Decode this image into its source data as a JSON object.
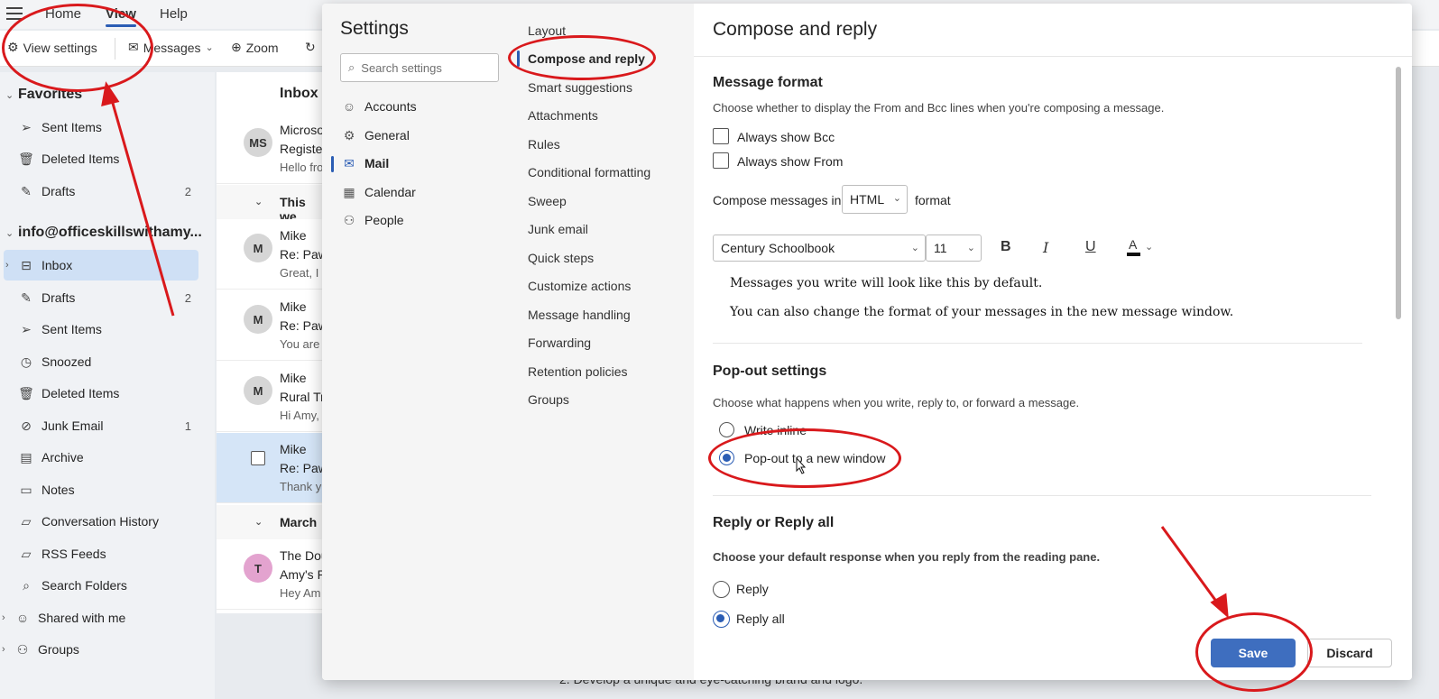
{
  "ribbon": {
    "tabs": [
      "Home",
      "View",
      "Help"
    ],
    "toolbar": {
      "view_settings": "View settings",
      "messages": "Messages",
      "zoom": "Zoom"
    }
  },
  "nav": {
    "favorites_header": "Favorites",
    "favorites": [
      {
        "label": "Sent Items",
        "icon": "send-icon",
        "count": ""
      },
      {
        "label": "Deleted Items",
        "icon": "trash-icon",
        "count": ""
      },
      {
        "label": "Drafts",
        "icon": "pencil-icon",
        "count": "2"
      }
    ],
    "account": "info@officeskillswithamy...",
    "folders": [
      {
        "label": "Inbox",
        "icon": "inbox-icon",
        "count": ""
      },
      {
        "label": "Drafts",
        "icon": "pencil-icon",
        "count": "2"
      },
      {
        "label": "Sent Items",
        "icon": "send-icon",
        "count": ""
      },
      {
        "label": "Snoozed",
        "icon": "clock-icon",
        "count": ""
      },
      {
        "label": "Deleted Items",
        "icon": "trash-icon",
        "count": ""
      },
      {
        "label": "Junk Email",
        "icon": "junk-icon",
        "count": "1"
      },
      {
        "label": "Archive",
        "icon": "archive-icon",
        "count": ""
      },
      {
        "label": "Notes",
        "icon": "note-icon",
        "count": ""
      },
      {
        "label": "Conversation History",
        "icon": "folder-icon",
        "count": ""
      },
      {
        "label": "RSS Feeds",
        "icon": "folder-icon",
        "count": ""
      },
      {
        "label": "Search Folders",
        "icon": "search-folder-icon",
        "count": ""
      },
      {
        "label": "Shared with me",
        "icon": "person-icon",
        "count": ""
      },
      {
        "label": "Groups",
        "icon": "groups-icon",
        "count": ""
      }
    ]
  },
  "message_list": {
    "header": "Inbox",
    "groups": [
      "This we",
      "March"
    ],
    "messages": [
      {
        "initials": "MS",
        "from": "Microso",
        "subject": "Register",
        "preview": "Hello fro",
        "avatar_color": "#d6d6d6"
      },
      {
        "initials": "M",
        "from": "Mike",
        "subject": "Re: Paw",
        "preview": "Great, I",
        "avatar_color": "#d6d6d6"
      },
      {
        "initials": "M",
        "from": "Mike",
        "subject": "Re: Paw",
        "preview": "You are",
        "avatar_color": "#d6d6d6"
      },
      {
        "initials": "M",
        "from": "Mike",
        "subject": "Rural Tra",
        "preview": "Hi Amy,",
        "avatar_color": "#d6d6d6"
      },
      {
        "initials": "",
        "from": "Mike",
        "subject": "Re: Paw",
        "preview": "Thank y",
        "avatar_color": "#d6d6d6"
      },
      {
        "initials": "T",
        "from": "The Dou",
        "subject": "Amy's P",
        "preview": "Hey Am",
        "avatar_color": "#e3a3cf"
      }
    ]
  },
  "settings": {
    "title": "Settings",
    "search_placeholder": "Search settings",
    "categories": [
      "Accounts",
      "General",
      "Mail",
      "Calendar",
      "People"
    ],
    "active_category": "Mail",
    "subcategories": [
      "Layout",
      "Compose and reply",
      "Smart suggestions",
      "Attachments",
      "Rules",
      "Conditional formatting",
      "Sweep",
      "Junk email",
      "Quick steps",
      "Customize actions",
      "Message handling",
      "Forwarding",
      "Retention policies",
      "Groups"
    ],
    "active_subcategory": "Compose and reply",
    "panel": {
      "title": "Compose and reply",
      "message_format": {
        "heading": "Message format",
        "description": "Choose whether to display the From and Bcc lines when you're composing a message.",
        "always_show_bcc": "Always show Bcc",
        "always_show_from": "Always show From",
        "compose_in_label": "Compose messages in",
        "compose_in_value": "HTML",
        "format_suffix": "format",
        "font_name": "Century Schoolbook",
        "font_size": "11",
        "preview_line1": "Messages you write will look like this by default.",
        "preview_line2": "You can also change the format of your messages in the new message window."
      },
      "popout": {
        "heading": "Pop-out settings",
        "description": "Choose what happens when you write, reply to, or forward a message.",
        "options": [
          "Write inline",
          "Pop-out to a new window"
        ],
        "selected": "Pop-out to a new window"
      },
      "reply": {
        "heading": "Reply or Reply all",
        "description": "Choose your default response when you reply from the reading pane.",
        "options": [
          "Reply",
          "Reply all"
        ],
        "selected": "Reply all"
      },
      "save_label": "Save",
      "discard_label": "Discard"
    }
  },
  "background_text": "2. Develop a unique and eye-catching brand and logo.",
  "colors": {
    "accent": "#2b5db4",
    "annotation": "#d9191c",
    "save_button": "#3e6ebf"
  }
}
